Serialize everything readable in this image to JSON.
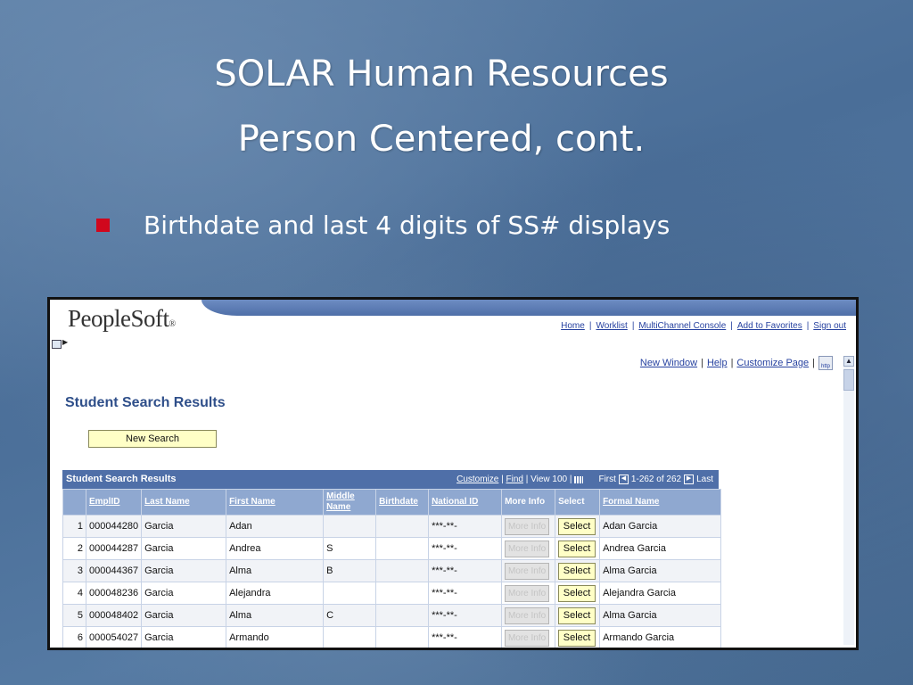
{
  "slide": {
    "title_line1": "SOLAR Human Resources",
    "title_line2": "Person Centered, cont.",
    "bullet": "Birthdate and last 4 digits of SS# displays"
  },
  "peoplesoft": {
    "logo": "PeopleSoft",
    "logo_mark": "®",
    "header_links": [
      "Home",
      "Worklist",
      "MultiChannel Console",
      "Add to Favorites",
      "Sign out"
    ],
    "page_links": [
      "New Window",
      "Help",
      "Customize Page"
    ],
    "help_icon_label": "http",
    "page_title": "Student Search Results",
    "new_search_label": "New Search"
  },
  "grid": {
    "title": "Student Search Results",
    "customize": "Customize",
    "find": "Find",
    "view100": "View 100",
    "first": "First",
    "range": "1-262 of 262",
    "last": "Last",
    "columns": [
      "EmplID",
      "Last Name",
      "First Name",
      "Middle Name",
      "Birthdate",
      "National ID",
      "More Info",
      "Select",
      "Formal Name"
    ],
    "more_info_label": "More Info",
    "select_label": "Select",
    "rows": [
      {
        "n": "1",
        "emplid": "000044280",
        "last": "Garcia",
        "first": "Adan",
        "middle": "",
        "birthdate": "",
        "national_id": "***-**-",
        "formal": "Adan Garcia"
      },
      {
        "n": "2",
        "emplid": "000044287",
        "last": "Garcia",
        "first": "Andrea",
        "middle": "S",
        "birthdate": "",
        "national_id": "***-**-",
        "formal": "Andrea Garcia"
      },
      {
        "n": "3",
        "emplid": "000044367",
        "last": "Garcia",
        "first": "Alma",
        "middle": "B",
        "birthdate": "",
        "national_id": "***-**-",
        "formal": "Alma Garcia"
      },
      {
        "n": "4",
        "emplid": "000048236",
        "last": "Garcia",
        "first": "Alejandra",
        "middle": "",
        "birthdate": "",
        "national_id": "***-**-",
        "formal": "Alejandra Garcia"
      },
      {
        "n": "5",
        "emplid": "000048402",
        "last": "Garcia",
        "first": "Alma",
        "middle": "C",
        "birthdate": "",
        "national_id": "***-**-",
        "formal": "Alma Garcia"
      },
      {
        "n": "6",
        "emplid": "000054027",
        "last": "Garcia",
        "first": "Armando",
        "middle": "",
        "birthdate": "",
        "national_id": "***-**-",
        "formal": "Armando Garcia"
      }
    ]
  },
  "colors": {
    "bullet": "#d0071d",
    "grid_header": "#4f6fa8",
    "column_header": "#8fa8d0",
    "select_button": "#ffffc6"
  }
}
